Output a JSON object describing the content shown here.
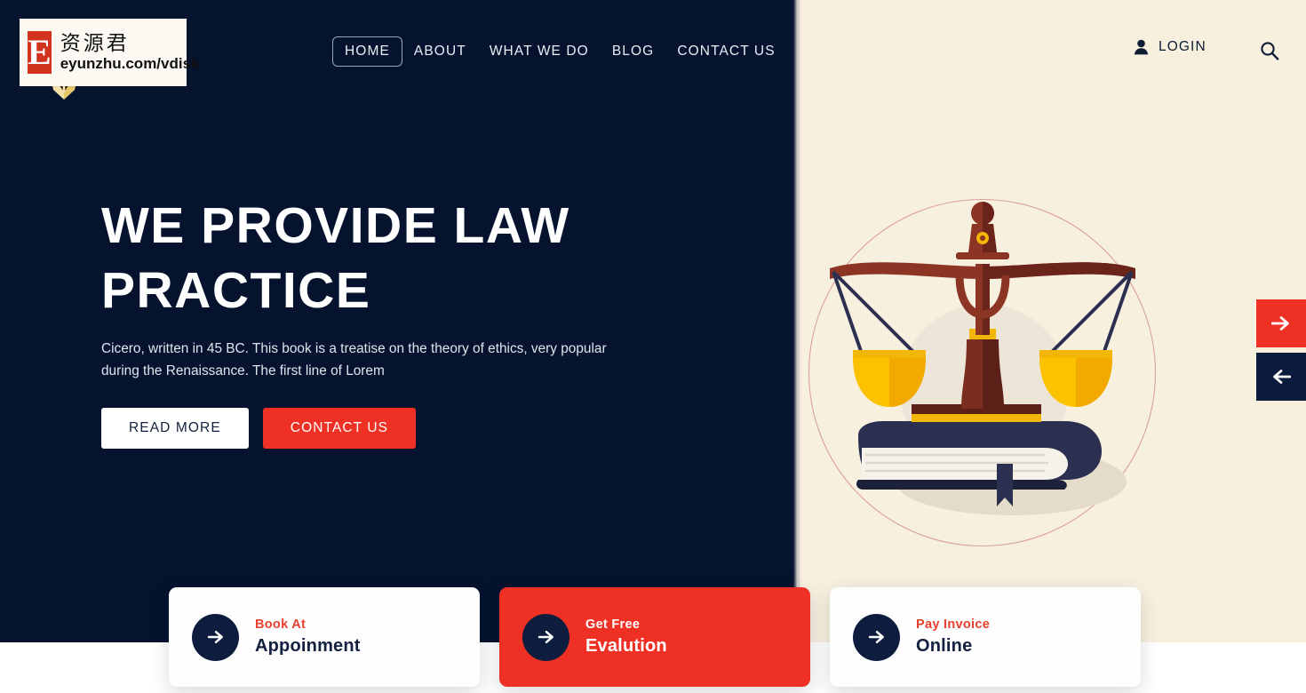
{
  "brand": {
    "nib_icon": "pen-nib-icon",
    "watermark": {
      "badge_letter": "E",
      "chinese": "资源君",
      "url": "eyunzhu.com/vdisk"
    }
  },
  "header": {
    "nav": [
      {
        "label": "HOME",
        "active": true
      },
      {
        "label": "ABOUT",
        "active": false
      },
      {
        "label": "WHAT WE DO",
        "active": false
      },
      {
        "label": "BLOG",
        "active": false
      },
      {
        "label": "CONTACT US",
        "active": false
      }
    ],
    "user_icon": "user-icon",
    "login_label": "LOGIN",
    "search_icon": "search-icon"
  },
  "hero": {
    "title": "WE PROVIDE LAW PRACTICE",
    "description": "Cicero, written in 45 BC. This book is a treatise on the theory of ethics, very popular during the Renaissance. The first line of Lorem",
    "primary_button": "READ MORE",
    "secondary_button": "CONTACT US",
    "illustration": "scales-of-justice-on-book-illustration"
  },
  "slider": {
    "next_icon": "arrow-right-icon",
    "prev_icon": "arrow-left-icon"
  },
  "cards": [
    {
      "sub": "Book At",
      "title": "Appoinment",
      "style": "white",
      "icon": "arrow-right-icon"
    },
    {
      "sub": "Get Free",
      "title": "Evalution",
      "style": "red",
      "icon": "arrow-right-icon"
    },
    {
      "sub": "Pay Invoice",
      "title": "Online",
      "style": "white",
      "icon": "arrow-right-icon"
    }
  ],
  "colors": {
    "dark_navy": "#06132f",
    "cream": "#f8f0df",
    "red": "#ee3124",
    "circle_outline": "#d9a09a",
    "white": "#ffffff"
  }
}
